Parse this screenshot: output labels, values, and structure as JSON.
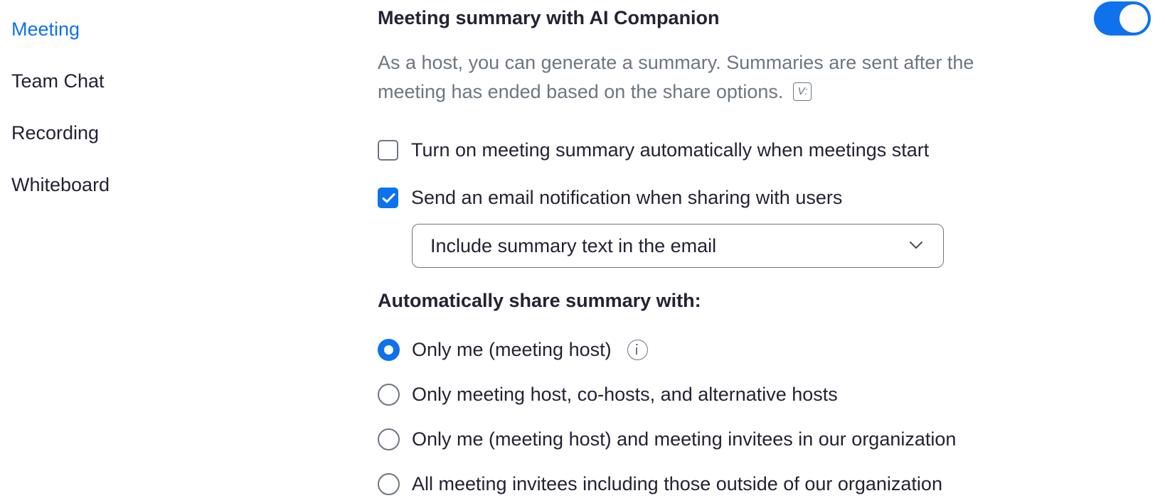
{
  "sidebar": {
    "items": [
      {
        "label": "Meeting",
        "active": true
      },
      {
        "label": "Team Chat",
        "active": false
      },
      {
        "label": "Recording",
        "active": false
      },
      {
        "label": "Whiteboard",
        "active": false
      }
    ]
  },
  "setting": {
    "title": "Meeting summary with AI Companion",
    "enabled": true,
    "description_line1": "As a host, you can generate a summary. Summaries are sent after the",
    "description_line2": "meeting has ended based on the share options.",
    "description_icon": "v-badge-icon"
  },
  "options": {
    "auto_start": {
      "label": "Turn on meeting summary automatically when meetings start",
      "checked": false
    },
    "email_notification": {
      "label": "Send an email notification when sharing with users",
      "checked": true
    },
    "email_content_select": {
      "value": "Include summary text in the email"
    }
  },
  "share": {
    "heading": "Automatically share summary with:",
    "choices": [
      {
        "label": "Only me (meeting host)",
        "selected": true,
        "has_info_icon": true
      },
      {
        "label": "Only meeting host, co-hosts, and alternative hosts",
        "selected": false
      },
      {
        "label": "Only me (meeting host) and meeting invitees in our organization",
        "selected": false
      },
      {
        "label": "All meeting invitees including those outside of our organization",
        "selected": false
      }
    ]
  },
  "colors": {
    "accent": "#0e72ed",
    "text": "#232333",
    "muted": "#6e7680"
  }
}
